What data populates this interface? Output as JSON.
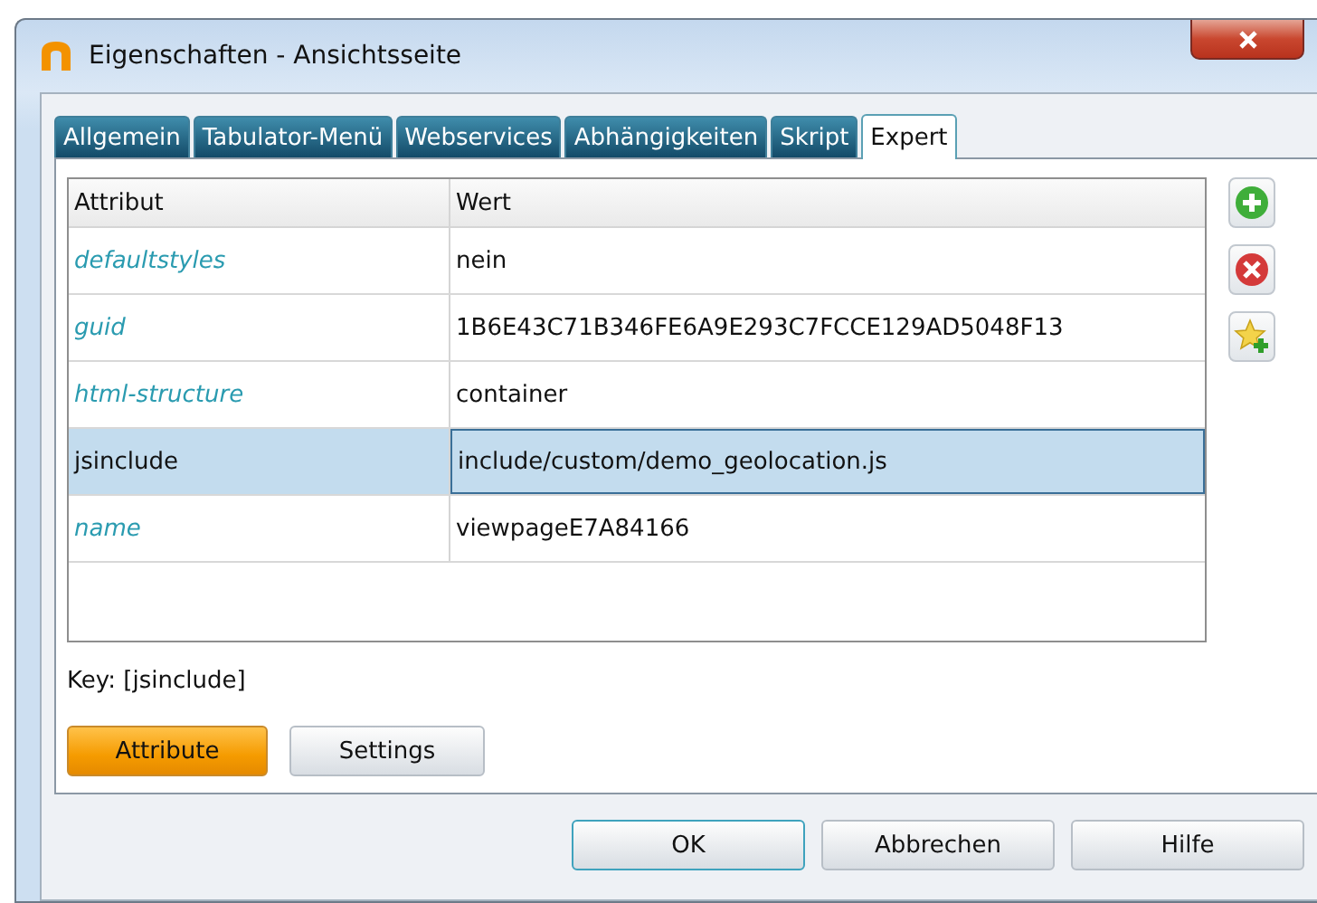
{
  "window": {
    "title": "Eigenschaften - Ansichtsseite"
  },
  "tabs": [
    {
      "label": "Allgemein",
      "selected": false
    },
    {
      "label": "Tabulator-Menü",
      "selected": false
    },
    {
      "label": "Webservices",
      "selected": false
    },
    {
      "label": "Abhängigkeiten",
      "selected": false
    },
    {
      "label": "Skript",
      "selected": false
    },
    {
      "label": "Expert",
      "selected": true
    }
  ],
  "table": {
    "columns": [
      "Attribut",
      "Wert"
    ],
    "rows": [
      {
        "attribute": "defaultstyles",
        "value": "nein",
        "inherited": true,
        "selected": false
      },
      {
        "attribute": "guid",
        "value": "1B6E43C71B346FE6A9E293C7FCCE129AD5048F13",
        "inherited": true,
        "selected": false
      },
      {
        "attribute": "html-structure",
        "value": "container",
        "inherited": true,
        "selected": false
      },
      {
        "attribute": "jsinclude",
        "value": "include/custom/demo_geolocation.js",
        "inherited": false,
        "selected": true
      },
      {
        "attribute": "name",
        "value": "viewpageE7A84166",
        "inherited": true,
        "selected": false
      }
    ]
  },
  "side_buttons": [
    {
      "kind": "add"
    },
    {
      "kind": "remove"
    },
    {
      "kind": "favorite"
    }
  ],
  "key_label": "Key: [jsinclude]",
  "view_buttons": [
    {
      "label": "Attribute",
      "selected": true
    },
    {
      "label": "Settings",
      "selected": false
    }
  ],
  "dialog_buttons": [
    {
      "label": "OK",
      "default": true
    },
    {
      "label": "Abbrechen",
      "default": false
    },
    {
      "label": "Hilfe",
      "default": false
    }
  ]
}
